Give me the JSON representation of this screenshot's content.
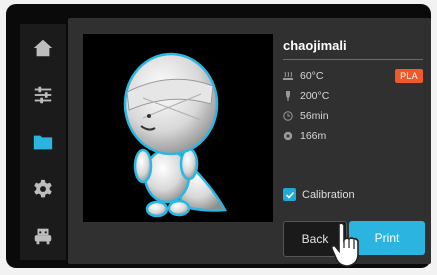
{
  "sidebar": {
    "items": [
      {
        "icon": "home-icon"
      },
      {
        "icon": "sliders-icon"
      },
      {
        "icon": "folder-icon",
        "active": true
      },
      {
        "icon": "gear-icon"
      },
      {
        "icon": "printer-icon"
      }
    ]
  },
  "file": {
    "name": "chaojimali",
    "bed_temp": "60°C",
    "material": "PLA",
    "nozzle_temp": "200°C",
    "duration": "56min",
    "filament_length": "166m"
  },
  "options": {
    "calibration_label": "Calibration",
    "calibration_checked": true
  },
  "actions": {
    "back_label": "Back",
    "print_label": "Print"
  },
  "colors": {
    "accent": "#2cb4e0",
    "material_badge": "#ee5a2a"
  }
}
